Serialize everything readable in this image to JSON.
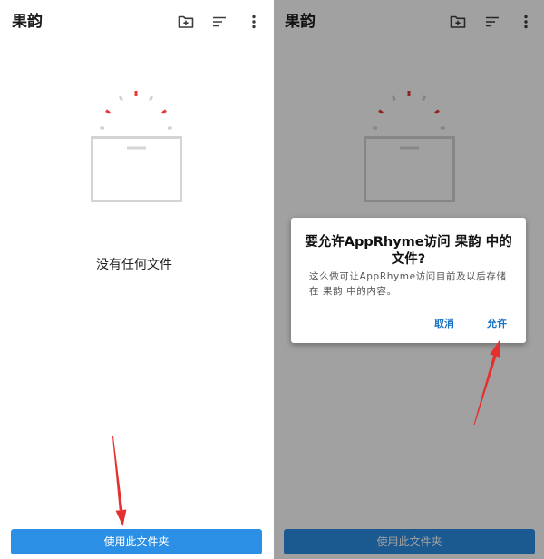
{
  "screens": [
    {
      "app_title": "果韵",
      "empty_text": "没有任何文件",
      "use_folder_button": "使用此文件夹"
    },
    {
      "app_title": "果韵",
      "use_folder_button": "使用此文件夹",
      "permission_dialog": {
        "title_lines": [
          "要允许AppRhyme访问 果韵 中的",
          "文件?"
        ],
        "body_lines": [
          "这么做可让AppRhyme访问目前及以后存储",
          "在 果韵 中的内容。"
        ],
        "cancel_label": "取消",
        "allow_label": "允许"
      }
    }
  ],
  "icons": {
    "new_folder": "new-folder-icon",
    "sort": "sort-icon",
    "more": "more-vertical-icon",
    "illustration": "empty-folder-illustration",
    "annotation": "red-arrow"
  },
  "colors": {
    "accent": "#2b8fe5",
    "dialog_button": "#1a73c6",
    "scrim": "rgba(0,0,0,0.37)",
    "annotation_arrow": "#e53030"
  }
}
